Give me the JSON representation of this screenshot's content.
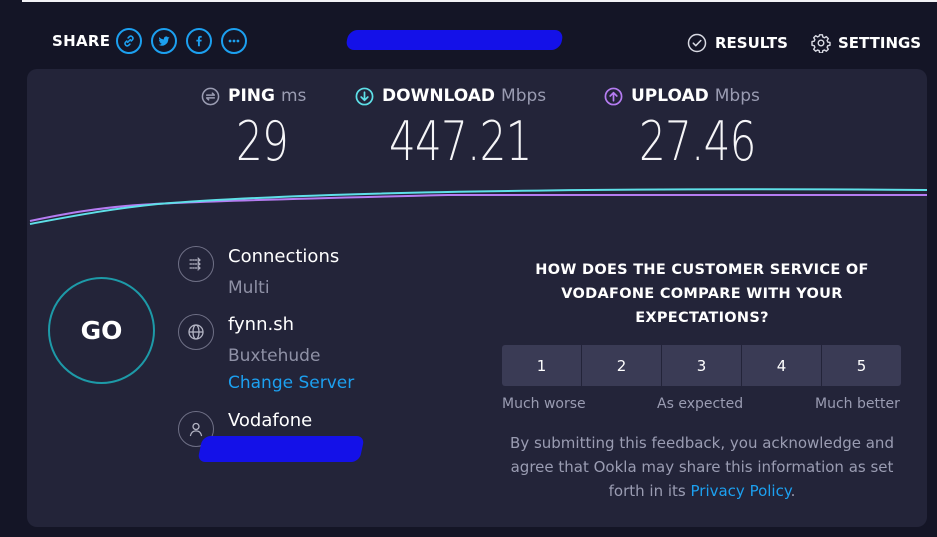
{
  "header": {
    "share_label": "SHARE",
    "share_icons": [
      "link-icon",
      "twitter-icon",
      "facebook-icon",
      "more-icon"
    ],
    "results_label": "RESULTS",
    "settings_label": "SETTINGS"
  },
  "metrics": {
    "ping": {
      "label": "PING",
      "unit": "ms",
      "value": "29",
      "icon": "ping-icon"
    },
    "download": {
      "label": "DOWNLOAD",
      "unit": "Mbps",
      "value": "447.21",
      "icon": "download-icon"
    },
    "upload": {
      "label": "UPLOAD",
      "unit": "Mbps",
      "value": "27.46",
      "icon": "upload-icon"
    }
  },
  "go_label": "GO",
  "connections": {
    "title": "Connections",
    "value": "Multi"
  },
  "server": {
    "name": "fynn.sh",
    "location": "Buxtehude",
    "change_label": "Change Server"
  },
  "provider": {
    "name": "Vodafone"
  },
  "survey": {
    "question": "HOW DOES THE CUSTOMER SERVICE OF VODAFONE COMPARE WITH YOUR EXPECTATIONS?",
    "options": [
      "1",
      "2",
      "3",
      "4",
      "5"
    ],
    "scale_low": "Much worse",
    "scale_mid": "As expected",
    "scale_high": "Much better",
    "disclaimer": "By submitting this feedback, you acknowledge and agree that Ookla may share this information as set forth in its",
    "privacy_link": "Privacy Policy",
    "disclaimer_end": "."
  },
  "colors": {
    "background": "#141526",
    "panel": "#232439",
    "accent_blue": "#1ca0f0",
    "download_teal": "#5ee0e8",
    "upload_purple": "#b57cf2",
    "redaction": "#1411e8"
  }
}
